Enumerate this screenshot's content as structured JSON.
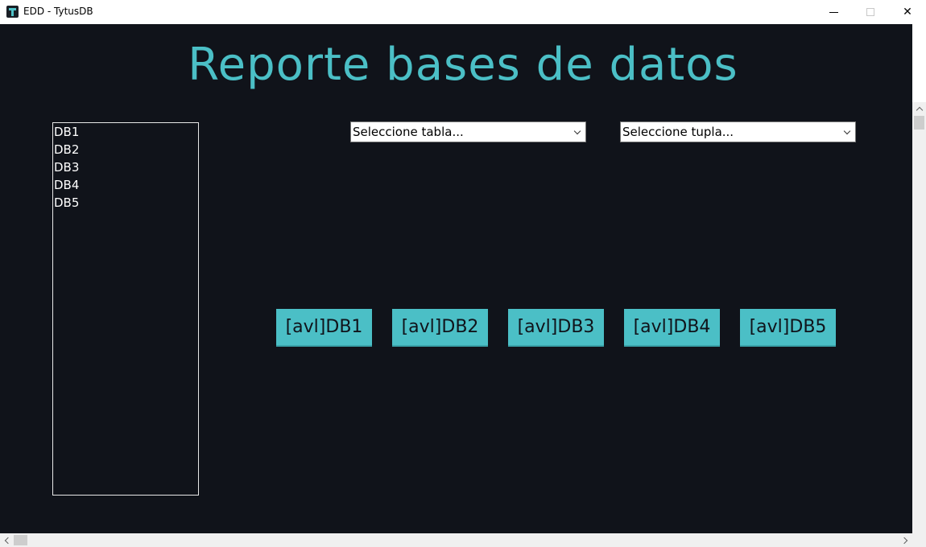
{
  "window": {
    "title": "EDD - TytusDB",
    "icon": "tytusdb-app-icon",
    "close_glyph": "✕"
  },
  "page": {
    "title": "Reporte bases de datos",
    "colors": {
      "background": "#10131a",
      "accent": "#4bbfc6"
    }
  },
  "databases": [
    "DB1",
    "DB2",
    "DB3",
    "DB4",
    "DB5"
  ],
  "selects": {
    "table_placeholder": "Seleccione tabla...",
    "tuple_placeholder": "Seleccione tupla..."
  },
  "avl_buttons": [
    "[avl]DB1",
    "[avl]DB2",
    "[avl]DB3",
    "[avl]DB4",
    "[avl]DB5"
  ]
}
